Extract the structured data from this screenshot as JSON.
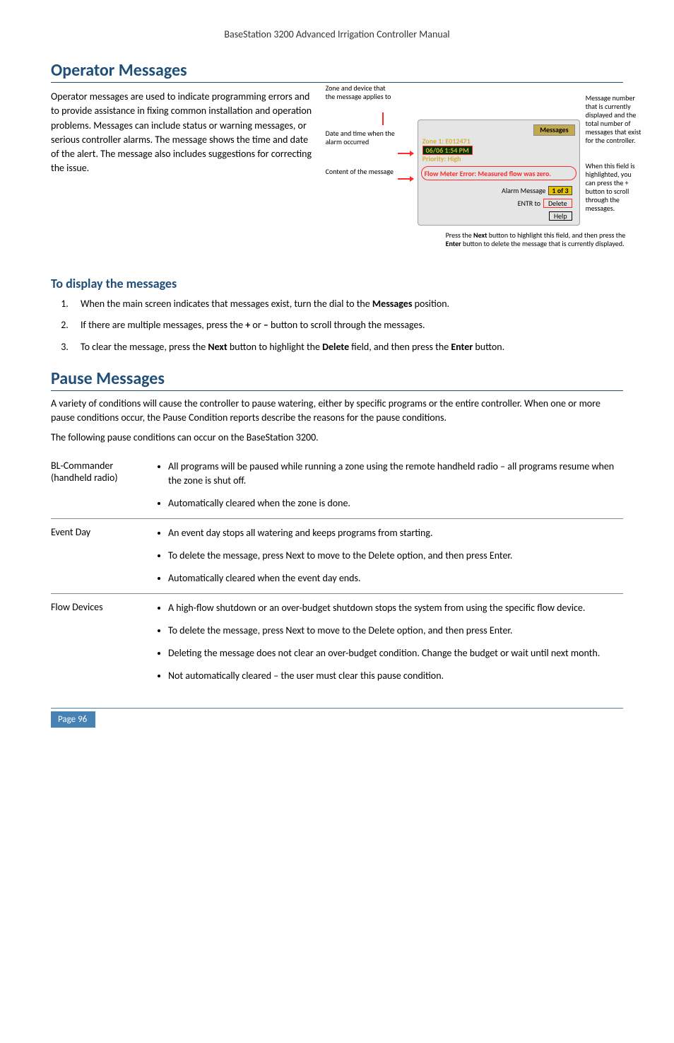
{
  "header": {
    "title": "BaseStation 3200 Advanced Irrigation Controller Manual"
  },
  "operator": {
    "heading": "Operator Messages",
    "para": "Operator messages are used to indicate programming errors and to provide assistance in fixing common installation and operation problems. Messages can include status or warning messages, or serious controller alarms. The message shows the time and date of the alert. The message also includes suggestions for correcting the issue.",
    "sub_heading": "To display the messages"
  },
  "diagram": {
    "label_zone": "Zone and device that the message applies to",
    "label_date": "Date and time when the alarm occurred",
    "label_content": "Content of the message",
    "panel_title": "Messages",
    "zone_line": "Zone 1: E012471",
    "date_box": "06/06 1:54 PM",
    "priority": "Priority: High",
    "err": "Flow Meter Error: Measured flow was zero.",
    "alarm_label": "Alarm Message",
    "alarm_val": "1 of 3",
    "entr_label": "ENTR to",
    "entr_val": "Delete",
    "help": "Help",
    "right_msgnum": "Message number that is currently displayed and the total number of messages that exist for the controller.",
    "right_scroll": "When this field is highlighted, you can press the + button to scroll through the messages.",
    "bottom_note_1": "Press the Next button to highlight this field, and then press the Enter button to delete the message that is currently displayed.",
    "bold_next": "Next",
    "bold_enter": "Enter"
  },
  "steps": {
    "s1_a": "When the main screen indicates that messages exist, turn the dial to the ",
    "s1_b": "Messages",
    "s1_c": " position.",
    "s2_a": "If there are multiple messages, press the ",
    "s2_b": "+",
    "s2_c": " or ",
    "s2_d": "–",
    "s2_e": " button to scroll through the messages.",
    "s3_a": "To clear the message, press the ",
    "s3_b": "Next",
    "s3_c": " button to highlight the ",
    "s3_d": "Delete",
    "s3_e": " field, and then press the ",
    "s3_f": "Enter",
    "s3_g": " button."
  },
  "pause": {
    "heading": "Pause Messages",
    "para1": "A variety of conditions will cause the controller to pause watering, either by specific programs or the entire controller. When one or more pause conditions occur, the Pause Condition reports describe the reasons for the pause conditions.",
    "para2": "The following pause conditions can occur on the BaseStation 3200."
  },
  "conds": [
    {
      "name": "BL-Commander (handheld radio)",
      "items": [
        "All programs will be paused while running a zone using the remote handheld radio – all programs resume when the zone is shut off.",
        "Automatically cleared when the zone is done."
      ]
    },
    {
      "name": "Event Day",
      "items": [
        "An event day stops all watering and keeps programs from starting.",
        "To delete the message, press Next to move to the Delete option, and then press Enter.",
        "Automatically cleared when the event day ends."
      ]
    },
    {
      "name": "Flow Devices",
      "items": [
        "A high-flow shutdown or an over-budget shutdown stops the system from using the specific flow device.",
        "To delete the message, press Next to move to the Delete option, and then press Enter.",
        "Deleting the message does not clear an over-budget condition. Change the budget or wait until next month.",
        "Not automatically cleared – the user must clear this pause condition."
      ]
    }
  ],
  "footer": {
    "page": "Page 96"
  }
}
